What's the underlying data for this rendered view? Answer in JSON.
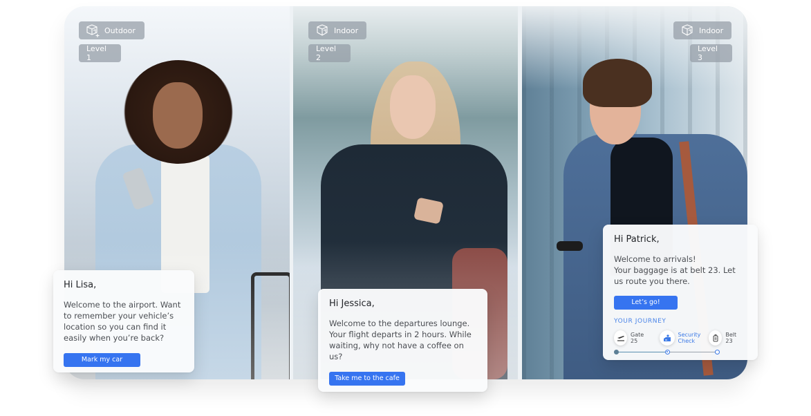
{
  "panels": [
    {
      "environment": "Outdoor",
      "environment_icon": "cube-plus-icon",
      "level": "Level 1",
      "card": {
        "greeting": "Hi Lisa,",
        "message": "Welcome to the airport. Want to remember your vehicle’s location so you can find it easily when you’re back?",
        "button": "Mark my car"
      }
    },
    {
      "environment": "Indoor",
      "environment_icon": "cube-icon",
      "level": "Level 2",
      "card": {
        "greeting": "Hi Jessica,",
        "message": "Welcome to the departures lounge. Your flight departs in 2 hours. While waiting, why not have a coffee on us?",
        "button": "Take me to the cafe"
      }
    },
    {
      "environment": "Indoor",
      "environment_icon": "cube-icon",
      "level": "Level 3",
      "card": {
        "greeting": "Hi Patrick,",
        "message_line1": "Welcome to arrivals!",
        "message_line2": "Your baggage is at belt 23. Let us route you there.",
        "button": "Let’s go!",
        "journey": {
          "title": "YOUR JOURNEY",
          "stops": [
            {
              "label": "Gate 25",
              "icon": "departure-plane-icon",
              "state": "done"
            },
            {
              "label_line1": "Security",
              "label_line2": "Check",
              "icon": "security-check-icon",
              "state": "current"
            },
            {
              "label": "Belt 23",
              "icon": "luggage-icon",
              "state": "next"
            }
          ]
        }
      }
    }
  ],
  "colors": {
    "accent": "#3674f0",
    "journey_accent": "#3b79e6",
    "badge_bg": "#949ca6"
  }
}
